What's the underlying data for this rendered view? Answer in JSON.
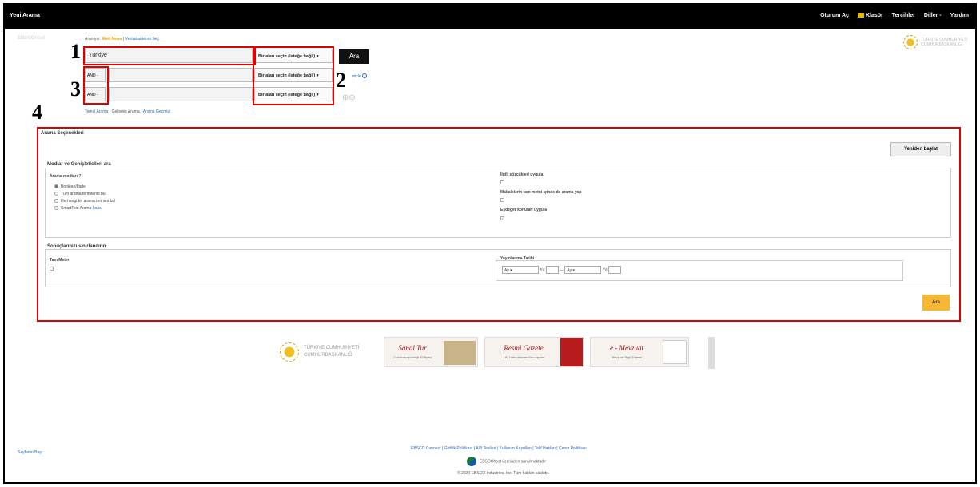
{
  "topbar": {
    "title": "Yeni Arama",
    "nav": [
      "Oturum Aç",
      "Klasör",
      "Tercihler",
      "Diller -",
      "Yardım"
    ]
  },
  "search": {
    "searching_label": "Aranıyor:",
    "database": "Web News",
    "choose_db": "Veritabanlarını Seç",
    "query1": "Türkiye",
    "field_select": "Bir alan seçin (isteğe bağlı)",
    "and_label": "AND -",
    "ara_button": "Ara",
    "help_fragment": "mizle"
  },
  "tabs": [
    "Temel Arama",
    "Gelişmiş Arama",
    "Arama Geçmişi"
  ],
  "annotations": [
    "1",
    "2",
    "3",
    "4"
  ],
  "gov_logo": [
    "TÜRKİYE CUMHURİYETİ",
    "CUMHURBAŞKANLIĞI"
  ],
  "options": {
    "title": "Arama Seçenekleri",
    "reset": "Yeniden başlat",
    "modes_section": "Modlar ve Genişleticileri ara",
    "modes_label": "Arama modları",
    "modes": [
      "Boolean/İfade",
      "Tüm arama terimlerini bul",
      "Herhangi bir arama terimini bul",
      "SmartText Arama"
    ],
    "hint": "İpucu",
    "expanders": [
      "İlgili sözcükleri uygula",
      "Makalelerin tam metni içinde de arama yap",
      "Eşdeğer konuları uygula"
    ],
    "limit_section": "Sonuçlarınızı sınırlandırın",
    "full_text": "Tam Metin",
    "pub_date": "Yayınlanma Tarihi",
    "month": "Ay",
    "year": "Yıl:",
    "ara": "Ara"
  },
  "banners": {
    "gov": [
      "TÜRKİYE CUMHURİYETİ",
      "CUMHURBAŞKANLIĞI"
    ],
    "b1_title": "Sanal Tur",
    "b1_sub": "Cumhurbaşkanlığı Külliyesi",
    "b2_title": "Resmi Gazete",
    "b2_sub": "1921'den itibaren tüm sayılar",
    "b3_title": "e - Mevzuat",
    "b3_sub": "Mevzuat Bilgi Sistemi"
  },
  "footer": {
    "top": "Sayfanın Başı",
    "links": "EBSCO Connect | Gizlilik Politikası | A/B Testleri | Kullanım Koşulları | Telif Hakları | Çerez Politikası",
    "by": "EBSCOhost üzerinden sunulmaktadır",
    "copyright": "© 2020 EBSCO Industries, Inc. Tüm hakları saklıdır."
  }
}
